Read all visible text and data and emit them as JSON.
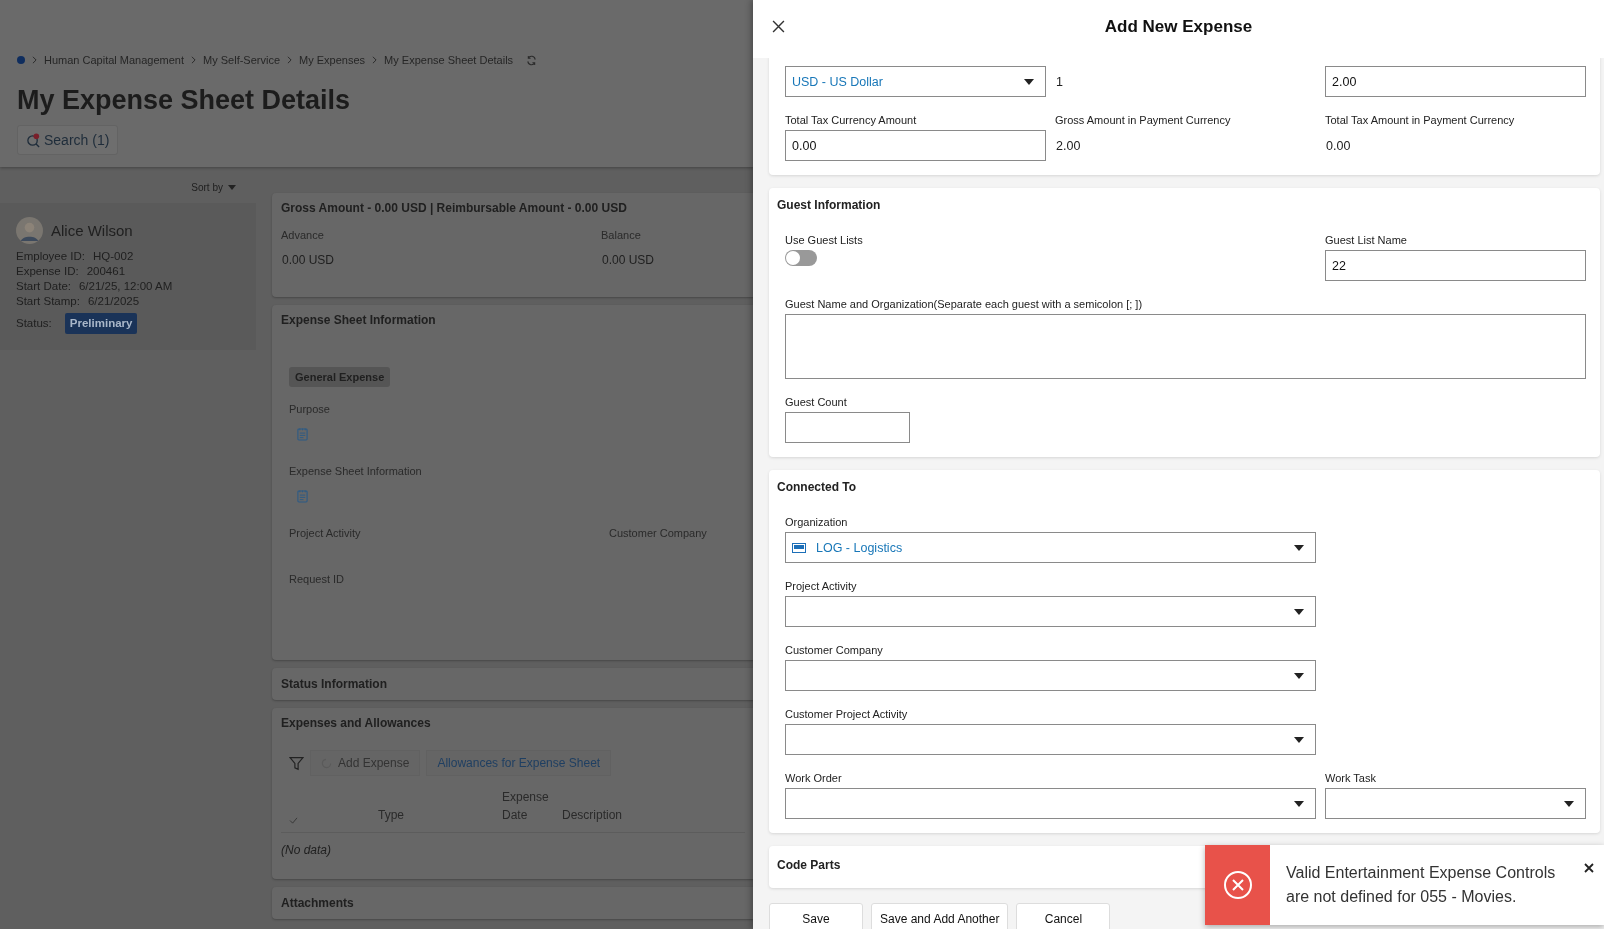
{
  "breadcrumb": {
    "items": [
      "Human Capital Management",
      "My Self-Service",
      "My Expenses",
      "My Expense Sheet Details"
    ]
  },
  "page_title": "My Expense Sheet Details",
  "search_button": "Search (1)",
  "sort_by": "Sort by",
  "person": {
    "name": "Alice Wilson",
    "fields": [
      {
        "label": "Employee ID:",
        "value": "HQ-002"
      },
      {
        "label": "Expense ID:",
        "value": "200461"
      },
      {
        "label": "Start Date:",
        "value": "6/21/25, 12:00 AM"
      },
      {
        "label": "Start Stamp:",
        "value": "6/21/2025"
      }
    ],
    "status_label": "Status:",
    "status": "Preliminary"
  },
  "summary_card": {
    "title": "Gross Amount - 0.00 USD | Reimbursable Amount - 0.00 USD",
    "fields": [
      {
        "label": "Advance",
        "value": "0.00 USD"
      },
      {
        "label": "Balance",
        "value": "0.00 USD"
      }
    ]
  },
  "expense_sheet_information": {
    "title": "Expense Sheet Information",
    "tag": "General Expense",
    "fields": [
      {
        "label": "Purpose",
        "kind": "note"
      },
      {
        "label": "Expense Sheet Information",
        "kind": "note"
      },
      {
        "label": "Project Activity",
        "kind": "text"
      },
      {
        "label": "Customer Company",
        "kind": "text"
      },
      {
        "label": "Request ID",
        "kind": "text"
      }
    ]
  },
  "status_information": {
    "title": "Status Information"
  },
  "expenses_and_allowances": {
    "title": "Expenses and Allowances",
    "toolbar": [
      {
        "label": "Add Expense",
        "kind": "action",
        "disabled": true
      },
      {
        "label": "Allowances for Expense Sheet",
        "kind": "link",
        "disabled": true
      }
    ],
    "columns": [
      "Type",
      "Expense Date",
      "Description"
    ],
    "empty": "(No data)"
  },
  "attachments": {
    "title": "Attachments"
  },
  "drawer": {
    "title": "Add New Expense",
    "amounts": [
      {
        "kind": "dropdown",
        "value": "USD - US Dollar"
      },
      {
        "kind": "text",
        "value": "1"
      },
      {
        "kind": "input",
        "value": "2.00"
      },
      {
        "kind": "input",
        "label": "Total Tax Currency Amount",
        "value": "0.00"
      },
      {
        "kind": "text",
        "label": "Gross Amount in Payment Currency",
        "value": "2.00"
      },
      {
        "kind": "text",
        "label": "Total Tax Amount in Payment Currency",
        "value": "0.00"
      }
    ],
    "guest_information": {
      "title": "Guest Information",
      "use_guest_lists": {
        "label": "Use Guest Lists",
        "on": false
      },
      "guest_list_name": {
        "label": "Guest List Name",
        "value": "22"
      },
      "guest_names": {
        "label": "Guest Name and Organization(Separate each guest with a semicolon [; ])"
      },
      "guest_count": {
        "label": "Guest Count"
      }
    },
    "connected_to": {
      "title": "Connected To",
      "fields": [
        {
          "label": "Organization",
          "value": "LOG - Logistics",
          "icon": true
        },
        {
          "label": "Project Activity"
        },
        {
          "label": "Customer Company"
        },
        {
          "label": "Customer Project Activity"
        },
        {
          "label": "Work Order"
        },
        {
          "label": "Work Task"
        }
      ]
    },
    "code_parts": {
      "title": "Code Parts"
    },
    "buttons": [
      "Save",
      "Save and Add Another",
      "Cancel"
    ]
  },
  "toast": {
    "kind": "error",
    "message": "Valid Entertainment Expense Controls are not defined for 055 - Movies."
  }
}
